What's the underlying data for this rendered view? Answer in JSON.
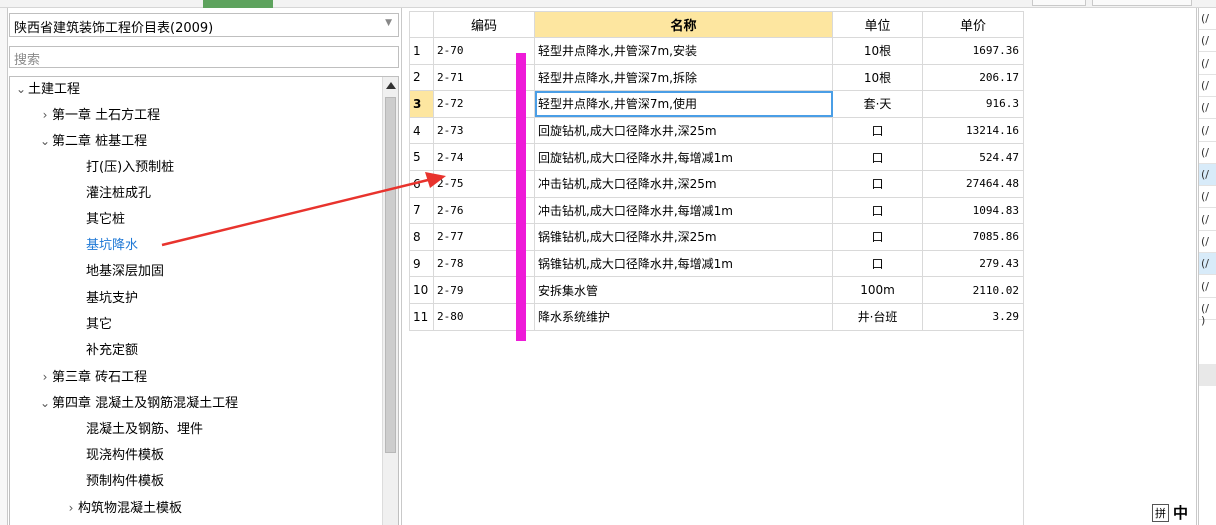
{
  "library_select": {
    "value": "陕西省建筑装饰工程价目表(2009)"
  },
  "search": {
    "placeholder": "搜索"
  },
  "tree": [
    {
      "label": "土建工程",
      "level": 0,
      "toggle": "expanded"
    },
    {
      "label": "第一章 土石方工程",
      "level": 1,
      "toggle": "collapsed"
    },
    {
      "label": "第二章 桩基工程",
      "level": 1,
      "toggle": "expanded"
    },
    {
      "label": "打(压)入预制桩",
      "level": 2,
      "toggle": "none"
    },
    {
      "label": "灌注桩成孔",
      "level": 2,
      "toggle": "none"
    },
    {
      "label": "其它桩",
      "level": 2,
      "toggle": "none"
    },
    {
      "label": "基坑降水",
      "level": 2,
      "toggle": "none",
      "selected": true
    },
    {
      "label": "地基深层加固",
      "level": 2,
      "toggle": "none"
    },
    {
      "label": "基坑支护",
      "level": 2,
      "toggle": "none"
    },
    {
      "label": "其它",
      "level": 2,
      "toggle": "none"
    },
    {
      "label": "补充定额",
      "level": 2,
      "toggle": "none"
    },
    {
      "label": "第三章 砖石工程",
      "level": 1,
      "toggle": "collapsed"
    },
    {
      "label": "第四章 混凝土及钢筋混凝土工程",
      "level": 1,
      "toggle": "expanded"
    },
    {
      "label": "混凝土及钢筋、埋件",
      "level": 2,
      "toggle": "none"
    },
    {
      "label": "现浇构件模板",
      "level": 2,
      "toggle": "none"
    },
    {
      "label": "预制构件模板",
      "level": 2,
      "toggle": "none"
    },
    {
      "label": "构筑物混凝土模板",
      "level": 2,
      "toggle": "collapsed"
    }
  ],
  "grid": {
    "headers": [
      "",
      "编码",
      "名称",
      "单位",
      "单价"
    ],
    "rows": [
      {
        "no": "1",
        "code": "2-70",
        "name": "轻型井点降水,井管深7m,安装",
        "unit": "10根",
        "price": "1697.36"
      },
      {
        "no": "2",
        "code": "2-71",
        "name": "轻型井点降水,井管深7m,拆除",
        "unit": "10根",
        "price": "206.17"
      },
      {
        "no": "3",
        "code": "2-72",
        "name": "轻型井点降水,井管深7m,使用",
        "unit": "套·天",
        "price": "916.3",
        "current": true
      },
      {
        "no": "4",
        "code": "2-73",
        "name": "回旋钻机,成大口径降水井,深25m",
        "unit": "口",
        "price": "13214.16"
      },
      {
        "no": "5",
        "code": "2-74",
        "name": "回旋钻机,成大口径降水井,每增减1m",
        "unit": "口",
        "price": "524.47"
      },
      {
        "no": "6",
        "code": "2-75",
        "name": "冲击钻机,成大口径降水井,深25m",
        "unit": "口",
        "price": "27464.48"
      },
      {
        "no": "7",
        "code": "2-76",
        "name": "冲击钻机,成大口径降水井,每增减1m",
        "unit": "口",
        "price": "1094.83"
      },
      {
        "no": "8",
        "code": "2-77",
        "name": "锅锥钻机,成大口径降水井,深25m",
        "unit": "口",
        "price": "7085.86"
      },
      {
        "no": "9",
        "code": "2-78",
        "name": "锅锥钻机,成大口径降水井,每增减1m",
        "unit": "口",
        "price": "279.43"
      },
      {
        "no": "10",
        "code": "2-79",
        "name": "安拆集水管",
        "unit": "100m",
        "price": "2110.02"
      },
      {
        "no": "11",
        "code": "2-80",
        "name": "降水系统维护",
        "unit": "井·台班",
        "price": "3.29"
      }
    ]
  },
  "right_panel": {
    "cells": [
      "(/",
      "(/",
      "(/",
      "(/",
      "(/",
      "(/",
      "(/",
      "(/",
      "(/",
      "(/",
      "(/",
      "(/",
      "(/",
      "(/"
    ],
    "highlight_rows": [
      7,
      11
    ],
    "last": ")"
  },
  "ime": {
    "mode_label": "拼",
    "lang_label": "中"
  },
  "annotation": {
    "arrow_color": "#e8332d",
    "bar_color": "#ee1bd8"
  },
  "colors": {
    "header_highlight": "#fde6a0",
    "selected_tree": "#1e78d6"
  }
}
